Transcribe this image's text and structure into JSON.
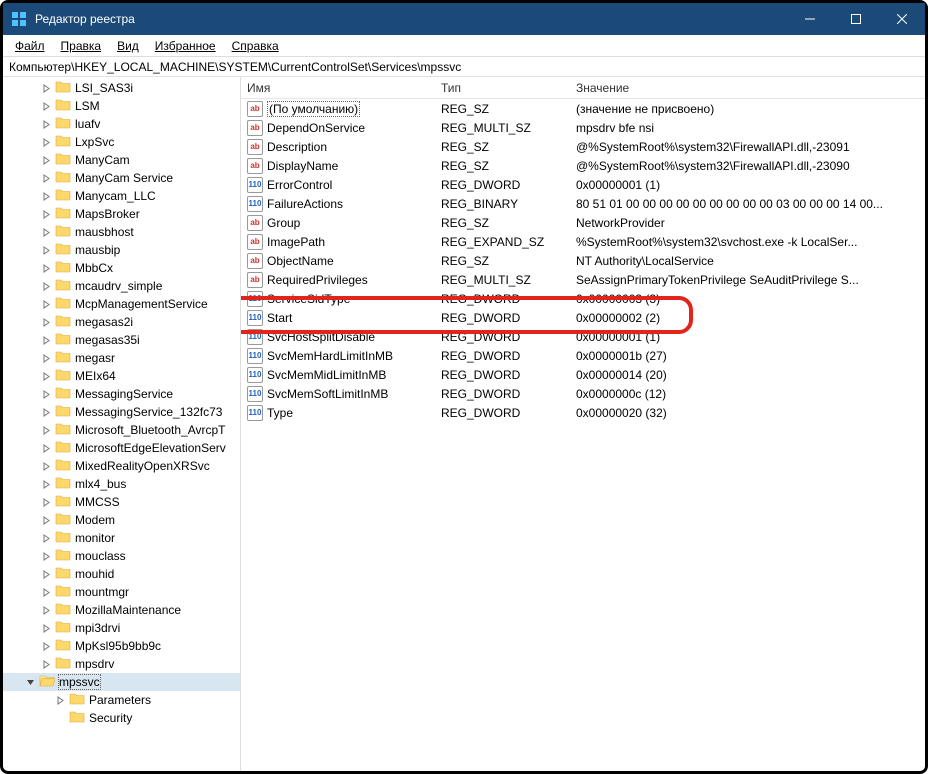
{
  "window": {
    "title": "Редактор реестра"
  },
  "menu": [
    "Файл",
    "Правка",
    "Вид",
    "Избранное",
    "Справка"
  ],
  "address": "Компьютер\\HKEY_LOCAL_MACHINE\\SYSTEM\\CurrentControlSet\\Services\\mpssvc",
  "tree": [
    {
      "label": "LSI_SAS3i"
    },
    {
      "label": "LSM"
    },
    {
      "label": "luafv"
    },
    {
      "label": "LxpSvc"
    },
    {
      "label": "ManyCam"
    },
    {
      "label": "ManyCam Service"
    },
    {
      "label": "Manycam_LLC"
    },
    {
      "label": "MapsBroker"
    },
    {
      "label": "mausbhost"
    },
    {
      "label": "mausbip"
    },
    {
      "label": "MbbCx"
    },
    {
      "label": "mcaudrv_simple"
    },
    {
      "label": "McpManagementService"
    },
    {
      "label": "megasas2i"
    },
    {
      "label": "megasas35i"
    },
    {
      "label": "megasr"
    },
    {
      "label": "MEIx64"
    },
    {
      "label": "MessagingService"
    },
    {
      "label": "MessagingService_132fc73"
    },
    {
      "label": "Microsoft_Bluetooth_AvrcpT"
    },
    {
      "label": "MicrosoftEdgeElevationServ"
    },
    {
      "label": "MixedRealityOpenXRSvc"
    },
    {
      "label": "mlx4_bus"
    },
    {
      "label": "MMCSS"
    },
    {
      "label": "Modem"
    },
    {
      "label": "monitor"
    },
    {
      "label": "mouclass"
    },
    {
      "label": "mouhid"
    },
    {
      "label": "mountmgr"
    },
    {
      "label": "MozillaMaintenance"
    },
    {
      "label": "mpi3drvi"
    },
    {
      "label": "MpKsl95b9bb9c"
    },
    {
      "label": "mpsdrv"
    },
    {
      "label": "mpssvc",
      "selected": true,
      "expanded": true,
      "children": [
        {
          "label": "Parameters",
          "expandable": true
        },
        {
          "label": "Security"
        }
      ]
    }
  ],
  "columns": {
    "name": "Имя",
    "type": "Тип",
    "value": "Значение"
  },
  "values": [
    {
      "icon": "str",
      "name": "(По умолчанию)",
      "type": "REG_SZ",
      "value": "(значение не присвоено)",
      "default": true
    },
    {
      "icon": "str",
      "name": "DependOnService",
      "type": "REG_MULTI_SZ",
      "value": "mpsdrv bfe nsi"
    },
    {
      "icon": "str",
      "name": "Description",
      "type": "REG_SZ",
      "value": "@%SystemRoot%\\system32\\FirewallAPI.dll,-23091"
    },
    {
      "icon": "str",
      "name": "DisplayName",
      "type": "REG_SZ",
      "value": "@%SystemRoot%\\system32\\FirewallAPI.dll,-23090"
    },
    {
      "icon": "bin",
      "name": "ErrorControl",
      "type": "REG_DWORD",
      "value": "0x00000001 (1)"
    },
    {
      "icon": "bin",
      "name": "FailureActions",
      "type": "REG_BINARY",
      "value": "80 51 01 00 00 00 00 00 00 00 00 00 03 00 00 00 14 00..."
    },
    {
      "icon": "str",
      "name": "Group",
      "type": "REG_SZ",
      "value": "NetworkProvider"
    },
    {
      "icon": "str",
      "name": "ImagePath",
      "type": "REG_EXPAND_SZ",
      "value": "%SystemRoot%\\system32\\svchost.exe -k LocalSer..."
    },
    {
      "icon": "str",
      "name": "ObjectName",
      "type": "REG_SZ",
      "value": "NT Authority\\LocalService"
    },
    {
      "icon": "str",
      "name": "RequiredPrivileges",
      "type": "REG_MULTI_SZ",
      "value": "SeAssignPrimaryTokenPrivilege SeAuditPrivilege S..."
    },
    {
      "icon": "bin",
      "name": "ServiceSidType",
      "type": "REG_DWORD",
      "value": "0x00000003 (3)"
    },
    {
      "icon": "bin",
      "name": "Start",
      "type": "REG_DWORD",
      "value": "0x00000002 (2)",
      "highlight": true
    },
    {
      "icon": "bin",
      "name": "SvcHostSplitDisable",
      "type": "REG_DWORD",
      "value": "0x00000001 (1)"
    },
    {
      "icon": "bin",
      "name": "SvcMemHardLimitInMB",
      "type": "REG_DWORD",
      "value": "0x0000001b (27)"
    },
    {
      "icon": "bin",
      "name": "SvcMemMidLimitInMB",
      "type": "REG_DWORD",
      "value": "0x00000014 (20)"
    },
    {
      "icon": "bin",
      "name": "SvcMemSoftLimitInMB",
      "type": "REG_DWORD",
      "value": "0x0000000c (12)"
    },
    {
      "icon": "bin",
      "name": "Type",
      "type": "REG_DWORD",
      "value": "0x00000020 (32)"
    }
  ]
}
